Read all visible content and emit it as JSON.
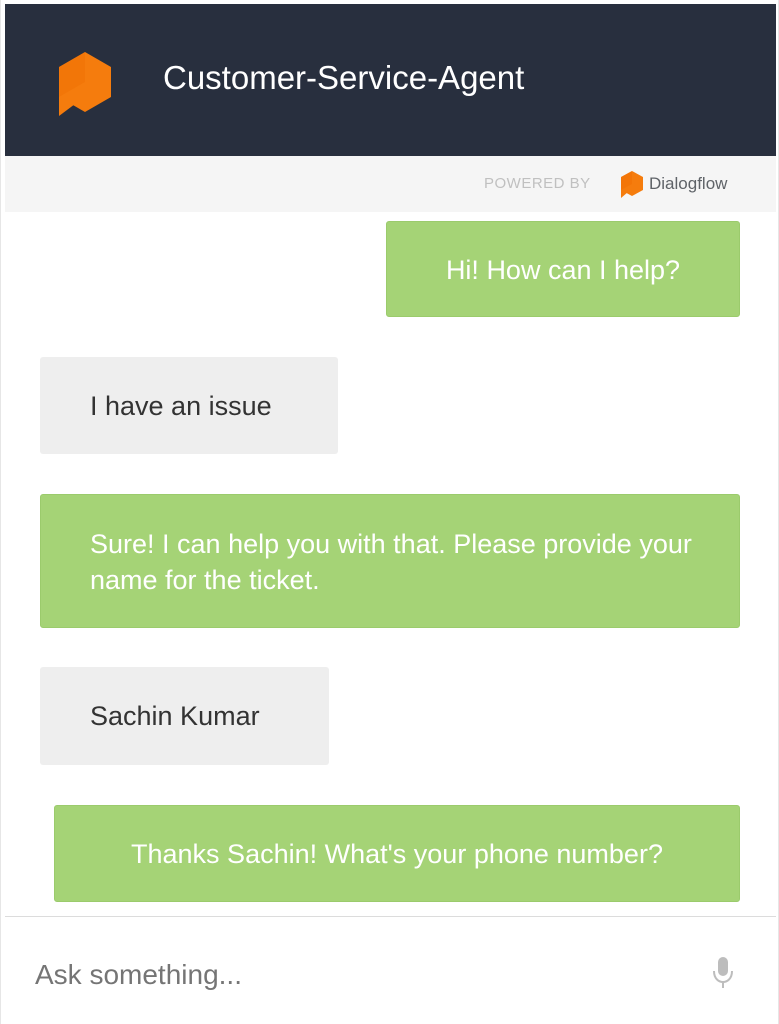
{
  "header": {
    "title": "Customer-Service-Agent",
    "logo_icon": "dialogflow-hexagon-bubble-icon",
    "background_color": "#282f3e",
    "logo_color": "#f57c0d"
  },
  "powered": {
    "label": "POWERED BY",
    "brand": "Dialogflow",
    "brand_icon": "dialogflow-logo-icon"
  },
  "messages": [
    {
      "sender": "bot",
      "text": "Hi! How can I help?"
    },
    {
      "sender": "user",
      "text": "I have an issue"
    },
    {
      "sender": "bot",
      "text": "Sure! I can help you with that. Please provide your name for the ticket."
    },
    {
      "sender": "user",
      "text": "Sachin Kumar"
    },
    {
      "sender": "bot",
      "text": "Thanks Sachin! What's your phone number?"
    }
  ],
  "colors": {
    "bot_bubble": "#a5d376",
    "user_bubble": "#eeeeee"
  },
  "input": {
    "placeholder": "Ask something...",
    "value": "",
    "mic_icon": "microphone-icon"
  }
}
